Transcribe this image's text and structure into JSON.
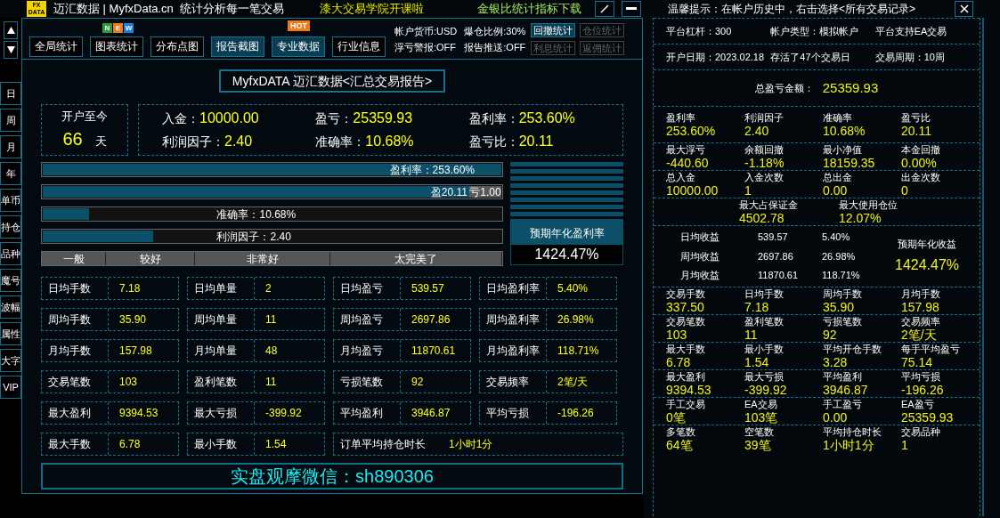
{
  "header": {
    "logo_top": "FX",
    "logo_bottom": "DATA",
    "title": "迈汇数据 | MyfxData.cn  统计分析每一笔交易",
    "promo": "漆大交易学院开课啦",
    "download": "金银比统计指标下载"
  },
  "side_tabs": [
    "日",
    "周",
    "月",
    "年",
    "单币",
    "持仓",
    "品种",
    "魔号",
    "波幅",
    "属性",
    "大字",
    "VIP"
  ],
  "toolbar": {
    "buttons": [
      {
        "label": "全局统计",
        "selected": false
      },
      {
        "label": "图表统计",
        "selected": false,
        "badge_letters": [
          "N",
          "E",
          "W"
        ]
      },
      {
        "label": "分布点图",
        "selected": false
      },
      {
        "label": "报告截图",
        "selected": true
      },
      {
        "label": "专业数据",
        "selected": true,
        "badge_text": "HOT"
      },
      {
        "label": "行业信息",
        "selected": false
      }
    ],
    "info": [
      "帐户货币:USD",
      "爆仓比例:30%",
      "浮亏警报:OFF",
      "报告推送:OFF"
    ],
    "stat_buttons": [
      {
        "label": "回撤统计",
        "disabled": false
      },
      {
        "label": "仓位统计",
        "disabled": true
      },
      {
        "label": "利息统计",
        "disabled": true
      },
      {
        "label": "返佣统计",
        "disabled": true
      }
    ]
  },
  "report_title": "MyfxDATA 迈汇数据<汇总交易报告>",
  "summary": {
    "since_label": "开户至今",
    "days": "66",
    "days_unit": "天",
    "stats": [
      {
        "label": "入金：",
        "value": "10000.00"
      },
      {
        "label": "盈亏：",
        "value": "25359.93"
      },
      {
        "label": "盈利率：",
        "value": "253.60%"
      },
      {
        "label": "利润因子：",
        "value": "2.40"
      },
      {
        "label": "准确率：",
        "value": "10.68%"
      },
      {
        "label": "盈亏比：",
        "value": "20.11"
      }
    ]
  },
  "bars": [
    {
      "kind": "single",
      "label": "盈利率：253.60%",
      "level": 1
    },
    {
      "kind": "split",
      "label": "盈20.11",
      "loss_label": "亏1.00",
      "level": 0.93
    },
    {
      "kind": "single",
      "label": "准确率：10.68%",
      "level": 0.1
    },
    {
      "kind": "single",
      "label": "利润因子：2.40",
      "level": 0.24
    }
  ],
  "rating": [
    "一般",
    "较好",
    "非常好",
    "太完美了"
  ],
  "annual": {
    "label": "预期年化盈利率",
    "value": "1424.47%"
  },
  "stats_grid": [
    [
      {
        "label": "日均手数",
        "value": "7.18"
      },
      {
        "label": "日均单量",
        "value": "2"
      },
      {
        "label": "日均盈亏",
        "value": "539.57"
      },
      {
        "label": "日均盈利率",
        "value": "5.40%"
      }
    ],
    [
      {
        "label": "周均手数",
        "value": "35.90"
      },
      {
        "label": "周均单量",
        "value": "11"
      },
      {
        "label": "周均盈亏",
        "value": "2697.86"
      },
      {
        "label": "周均盈利率",
        "value": "26.98%"
      }
    ],
    [
      {
        "label": "月均手数",
        "value": "157.98"
      },
      {
        "label": "月均单量",
        "value": "48"
      },
      {
        "label": "月均盈亏",
        "value": "11870.61"
      },
      {
        "label": "月均盈利率",
        "value": "118.71%"
      }
    ],
    [
      {
        "label": "交易笔数",
        "value": "103"
      },
      {
        "label": "盈利笔数",
        "value": "11"
      },
      {
        "label": "亏损笔数",
        "value": "92"
      },
      {
        "label": "交易频率",
        "value": "2笔/天"
      }
    ],
    [
      {
        "label": "最大盈利",
        "value": "9394.53"
      },
      {
        "label": "最大亏损",
        "value": "-399.92"
      },
      {
        "label": "平均盈利",
        "value": "3946.87"
      },
      {
        "label": "平均亏损",
        "value": "-196.26"
      }
    ],
    [
      {
        "label": "最大手数",
        "value": "6.78"
      },
      {
        "label": "最小手数",
        "value": "1.54"
      },
      {
        "label": "订单平均持仓时长",
        "value": "1小时1分"
      }
    ]
  ],
  "footer": "实盘观摩微信：sh890306",
  "right_panel": {
    "tip": "温馨提示：在帐户历史中，右击选择<所有交易记录>",
    "sections": [
      {
        "kind": "line",
        "items": [
          "平台杠杆：300",
          "帐户类型：模拟帐户",
          "平台支持EA交易"
        ]
      },
      {
        "kind": "line",
        "items": [
          "开户日期：2023.02.18",
          "存活了47个交易日",
          "交易周期：10周"
        ]
      },
      {
        "kind": "total",
        "label": "总盈亏金额：",
        "value": "25359.93"
      },
      {
        "kind": "grid",
        "items": [
          {
            "label": "盈利率",
            "value": "253.60%"
          },
          {
            "label": "利润因子",
            "value": "2.40"
          },
          {
            "label": "准确率",
            "value": "10.68%"
          },
          {
            "label": "盈亏比",
            "value": "20.11"
          }
        ]
      },
      {
        "kind": "grid",
        "items": [
          {
            "label": "最大浮亏",
            "value": "-440.60"
          },
          {
            "label": "余额回撤",
            "value": "-1.18%"
          },
          {
            "label": "最小净值",
            "value": "18159.35"
          },
          {
            "label": "本金回撤",
            "value": "0.00%"
          }
        ]
      },
      {
        "kind": "grid",
        "items": [
          {
            "label": "总入金",
            "value": "10000.00"
          },
          {
            "label": "入金次数",
            "value": "1"
          },
          {
            "label": "总出金",
            "value": "0.00"
          },
          {
            "label": "出金次数",
            "value": "0"
          }
        ]
      },
      {
        "kind": "pair",
        "items": [
          {
            "label": "最大占保证金",
            "value": "4502.78"
          },
          {
            "label": "最大使用仓位",
            "value": "12.07%"
          }
        ]
      },
      {
        "kind": "income",
        "rows": [
          [
            "日均收益",
            "539.57",
            "5.40%"
          ],
          [
            "周均收益",
            "2697.86",
            "26.98%"
          ],
          [
            "月均收益",
            "11870.61",
            "118.71%"
          ]
        ],
        "annual_label": "预期年化收益",
        "annual_value": "1424.47%"
      },
      {
        "kind": "grid",
        "items": [
          {
            "label": "交易手数",
            "value": "337.50"
          },
          {
            "label": "日均手数",
            "value": "7.18"
          },
          {
            "label": "周均手数",
            "value": "35.90"
          },
          {
            "label": "月均手数",
            "value": "157.98"
          }
        ]
      },
      {
        "kind": "grid",
        "items": [
          {
            "label": "交易笔数",
            "value": "103"
          },
          {
            "label": "盈利笔数",
            "value": "11"
          },
          {
            "label": "亏损笔数",
            "value": "92"
          },
          {
            "label": "交易频率",
            "value": "2笔/天"
          }
        ]
      },
      {
        "kind": "grid",
        "items": [
          {
            "label": "最大手数",
            "value": "6.78"
          },
          {
            "label": "最小手数",
            "value": "1.54"
          },
          {
            "label": "平均开仓手数",
            "value": "3.28"
          },
          {
            "label": "每手平均盈亏",
            "value": "75.14"
          }
        ]
      },
      {
        "kind": "grid",
        "items": [
          {
            "label": "最大盈利",
            "value": "9394.53"
          },
          {
            "label": "最大亏损",
            "value": "-399.92"
          },
          {
            "label": "平均盈利",
            "value": "3946.87"
          },
          {
            "label": "平均亏损",
            "value": "-196.26"
          }
        ]
      },
      {
        "kind": "grid",
        "items": [
          {
            "label": "手工交易",
            "value": "0笔"
          },
          {
            "label": "EA交易",
            "value": "103笔"
          },
          {
            "label": "手工盈亏",
            "value": "0.00"
          },
          {
            "label": "EA盈亏",
            "value": "25359.93"
          }
        ]
      },
      {
        "kind": "grid",
        "items": [
          {
            "label": "多笔数",
            "value": "64笔"
          },
          {
            "label": "空笔数",
            "value": "39笔"
          },
          {
            "label": "平均持仓时长",
            "value": "1小时1分"
          },
          {
            "label": "交易品种",
            "value": "1"
          }
        ]
      }
    ]
  }
}
